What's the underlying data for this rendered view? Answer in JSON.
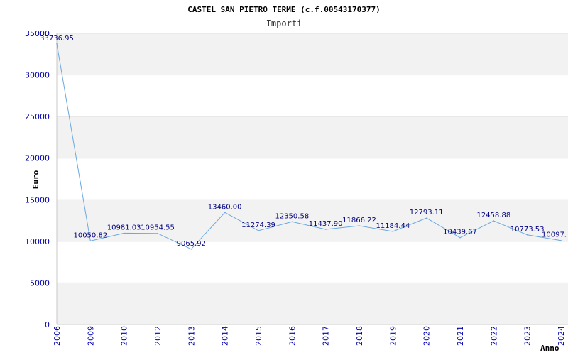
{
  "chart_data": {
    "type": "line",
    "title": "CASTEL SAN PIETRO TERME (c.f.00543170377)",
    "subtitle": "Importi",
    "ylabel": "Euro",
    "xlabel": "Anno",
    "ylim": [
      0,
      35000
    ],
    "yticks": [
      0,
      5000,
      10000,
      15000,
      20000,
      25000,
      30000,
      35000
    ],
    "grid": "alternating horizontal bands",
    "colors": {
      "line": "#6aa8e0",
      "band": "#f2f2f2",
      "axis": "#0000aa",
      "labels": "#000080"
    },
    "categories": [
      "2006",
      "2009",
      "2010",
      "2012",
      "2013",
      "2014",
      "2015",
      "2016",
      "2017",
      "2018",
      "2019",
      "2020",
      "2021",
      "2022",
      "2023",
      "2024"
    ],
    "values": [
      33736.95,
      10050.82,
      10981.03,
      10954.55,
      9065.92,
      13460.0,
      11274.39,
      12350.58,
      11437.9,
      11866.22,
      11184.44,
      12793.11,
      10439.67,
      12458.88,
      10773.53,
      10097.0
    ],
    "value_labels": [
      "33736.95",
      "10050.82",
      "10981.03",
      "10954.55",
      "9065.92",
      "13460.00",
      "11274.39",
      "12350.58",
      "11437.90",
      "11866.22",
      "11184.44",
      "12793.11",
      "10439.67",
      "12458.88",
      "10773.53",
      "10097."
    ]
  }
}
